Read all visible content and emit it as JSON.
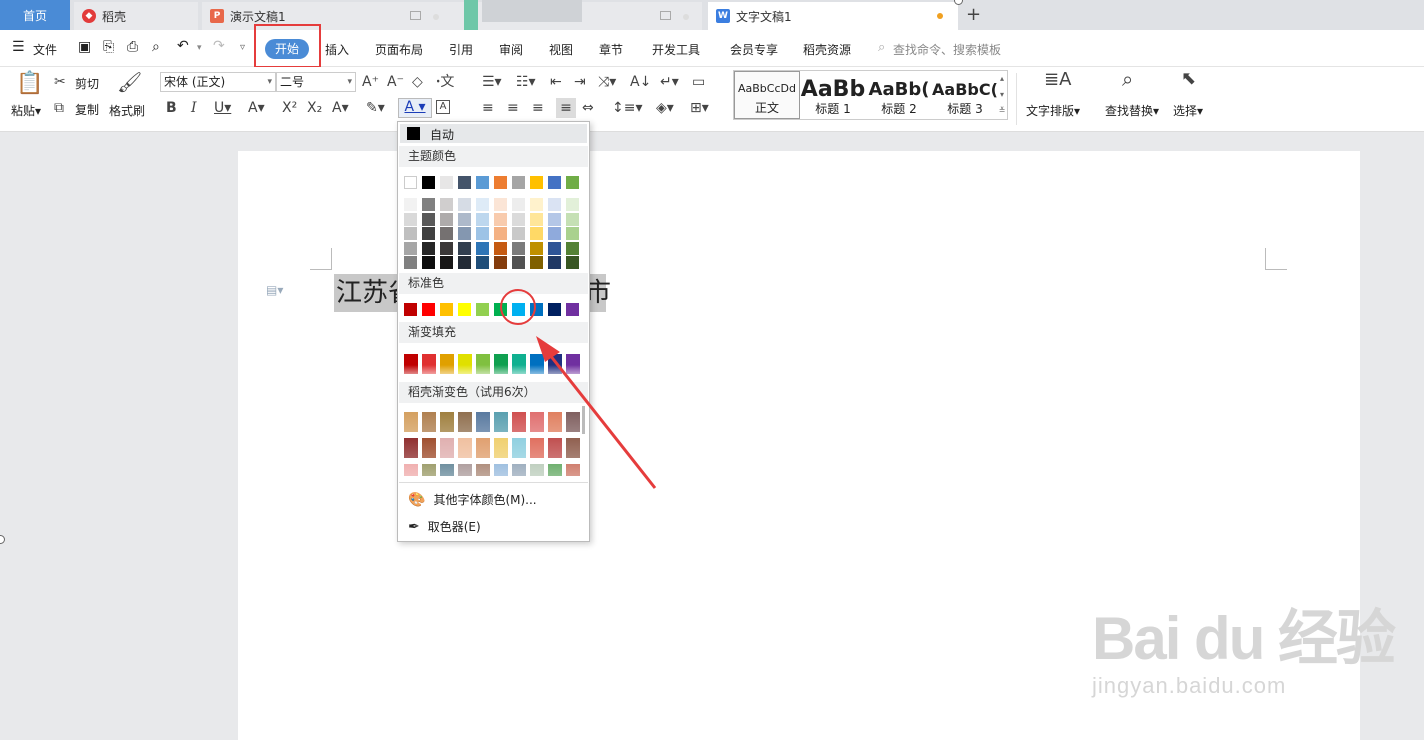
{
  "tabs": [
    {
      "label": "首页"
    },
    {
      "label": "稻壳"
    },
    {
      "label": "演示文稿1"
    },
    {
      "label": "文字文稿1"
    }
  ],
  "tab_add": "+",
  "menu": {
    "file": "文件",
    "items": [
      "开始",
      "插入",
      "页面布局",
      "引用",
      "审阅",
      "视图",
      "章节",
      "开发工具",
      "会员专享",
      "稻壳资源"
    ],
    "search": "查找命令、搜索模板"
  },
  "ribbon": {
    "paste": "粘贴",
    "cut": "剪切",
    "copy": "复制",
    "format_painter": "格式刷",
    "font_name": "宋体 (正文)",
    "font_size": "二号",
    "styles": [
      {
        "preview": "AaBbCcDd",
        "label": "正文"
      },
      {
        "preview": "AaBb",
        "label": "标题 1"
      },
      {
        "preview": "AaBb(",
        "label": "标题 2"
      },
      {
        "preview": "AaBbC(",
        "label": "标题 3"
      }
    ],
    "text_layout": "文字排版",
    "find_replace": "查找替换",
    "select": "选择"
  },
  "document": {
    "text_visible_start": "江苏省",
    "text_visible_end": "市"
  },
  "color_menu": {
    "auto": "自动",
    "theme_header": "主题颜色",
    "theme_top": [
      "#ffffff",
      "#000000",
      "#e7e6e6",
      "#44546a",
      "#5b9bd5",
      "#ed7d31",
      "#a5a5a5",
      "#ffc000",
      "#4472c4",
      "#70ad47"
    ],
    "theme_shades": [
      [
        "#f2f2f2",
        "#808080",
        "#d0cece",
        "#d6dce5",
        "#deebf7",
        "#fbe5d6",
        "#ededed",
        "#fff2cc",
        "#dae3f3",
        "#e2f0d9"
      ],
      [
        "#d9d9d9",
        "#595959",
        "#aeabab",
        "#adb9ca",
        "#bdd7ee",
        "#f8cbad",
        "#dbdbdb",
        "#ffe699",
        "#b4c7e7",
        "#c5e0b4"
      ],
      [
        "#bfbfbf",
        "#404040",
        "#757171",
        "#8497b0",
        "#9dc3e6",
        "#f4b183",
        "#c9c9c9",
        "#ffd966",
        "#8faadc",
        "#a9d18e"
      ],
      [
        "#a6a6a6",
        "#262626",
        "#3b3838",
        "#323f4f",
        "#2e75b6",
        "#c55a11",
        "#7b7b7b",
        "#bf9000",
        "#2f5597",
        "#548235"
      ],
      [
        "#808080",
        "#0d0d0d",
        "#171616",
        "#222a35",
        "#1f4e79",
        "#843c0c",
        "#525252",
        "#7f6000",
        "#203864",
        "#385723"
      ]
    ],
    "standard_header": "标准色",
    "standard": [
      "#c00000",
      "#ff0000",
      "#ffc000",
      "#ffff00",
      "#92d050",
      "#00b050",
      "#00b0f0",
      "#0070c0",
      "#002060",
      "#7030a0"
    ],
    "gradient_header": "渐变填充",
    "gradient": [
      "#c00000",
      "#e03030",
      "#e0a000",
      "#e0e000",
      "#80c040",
      "#10a050",
      "#10b090",
      "#0070c0",
      "#203080",
      "#7030a0"
    ],
    "docer_header": "稻壳渐变色（试用6次）",
    "docer_rows": [
      [
        "#d4a060",
        "#b08050",
        "#a08040",
        "#907050",
        "#5a7aa0",
        "#5aa0b0",
        "#d05050",
        "#e07070",
        "#e08060",
        "#806060"
      ],
      [
        "#903030",
        "#a05030",
        "#e0b0b0",
        "#f0c0a0",
        "#e0a070",
        "#f0d070",
        "#90d0e0",
        "#e07060",
        "#c05050",
        "#906050"
      ],
      [
        "#f0b0b0",
        "#a0a070",
        "#7090a0",
        "#b0a0a0",
        "#b09080",
        "#a0c0e0",
        "#a0b0c0",
        "#c0d0c0",
        "#70b070",
        "#d08070"
      ]
    ],
    "more_colors": "其他字体颜色(M)...",
    "eyedropper": "取色器(E)"
  },
  "watermark": {
    "brand": "Bai du 经验",
    "url": "jingyan.baidu.com"
  }
}
